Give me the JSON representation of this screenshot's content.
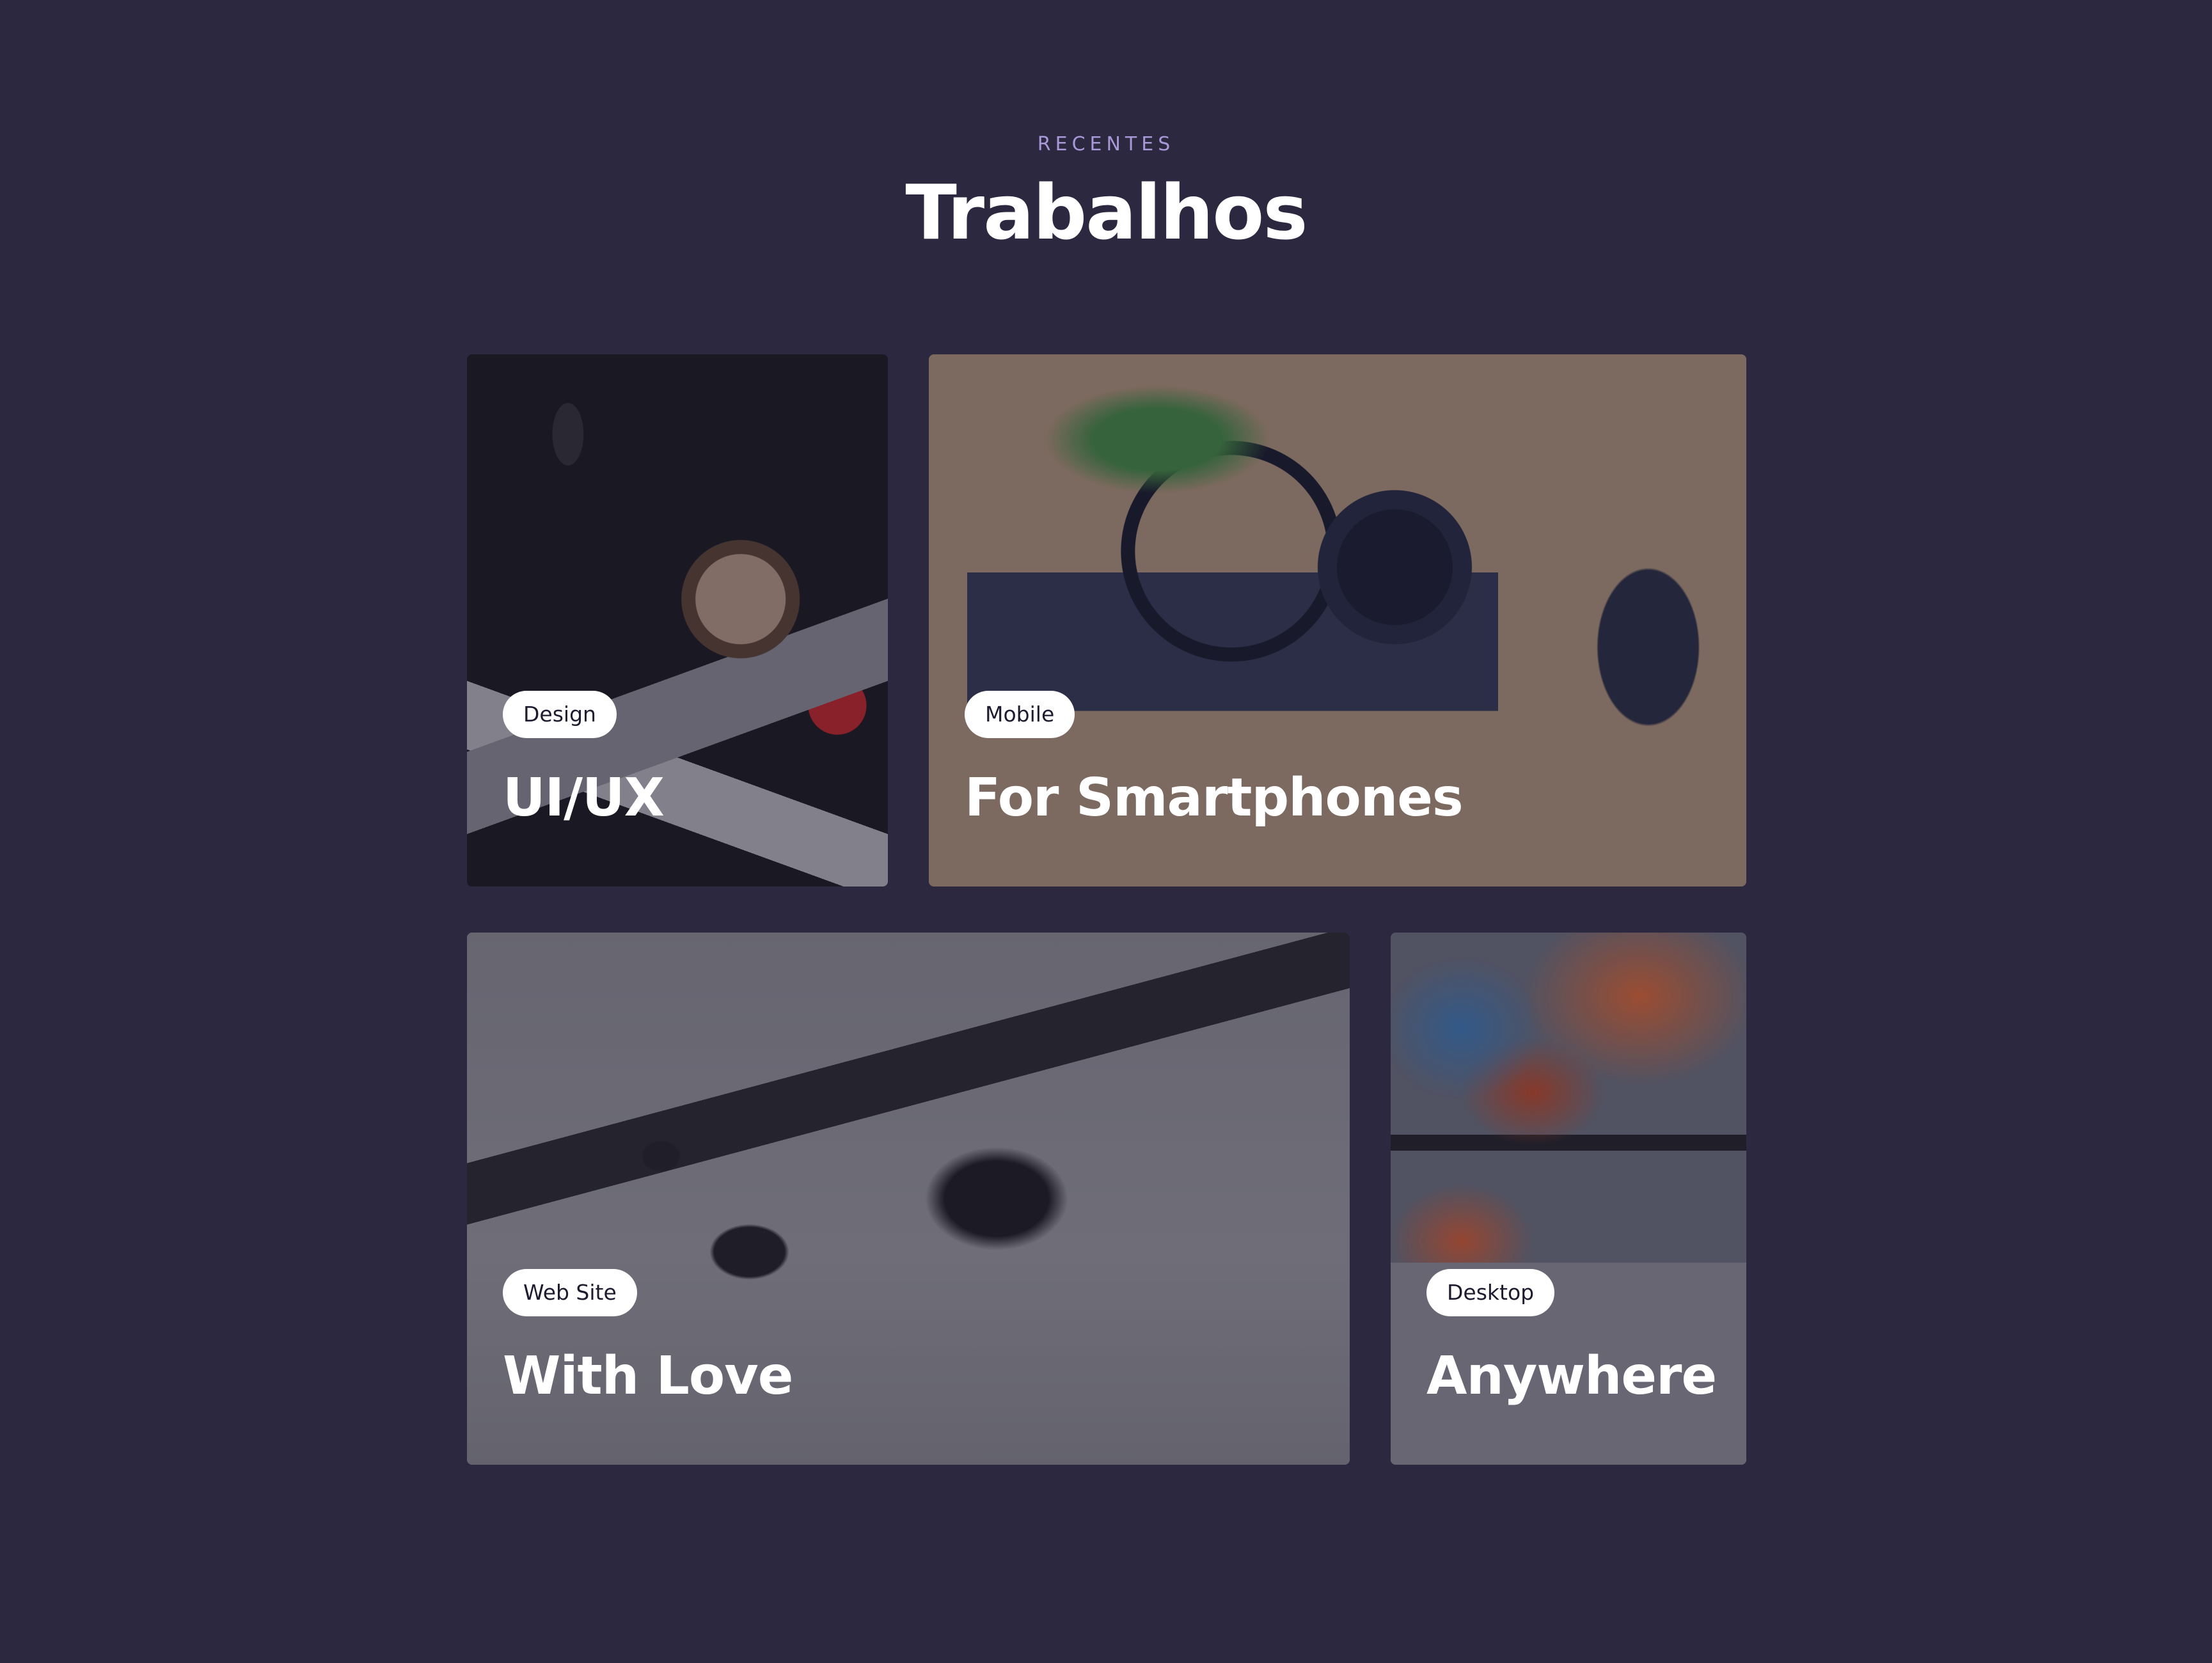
{
  "section": {
    "eyebrow": "RECENTES",
    "title": "Trabalhos"
  },
  "cards": [
    {
      "tag": "Design",
      "title": "UI/UX",
      "image": "desk-accessories-photo"
    },
    {
      "tag": "Mobile",
      "title": "For Smartphones",
      "image": "headphones-keyboard-photo"
    },
    {
      "tag": "Web Site",
      "title": "With Love",
      "image": "laptop-headphones-photo"
    },
    {
      "tag": "Desktop",
      "title": "Anywhere",
      "image": "monitor-laptop-photo"
    }
  ],
  "colors": {
    "background": "#2b2840",
    "eyebrow": "#a898d8",
    "title": "#ffffff",
    "badge_bg": "#ffffff",
    "badge_text": "#1e1b2e"
  }
}
